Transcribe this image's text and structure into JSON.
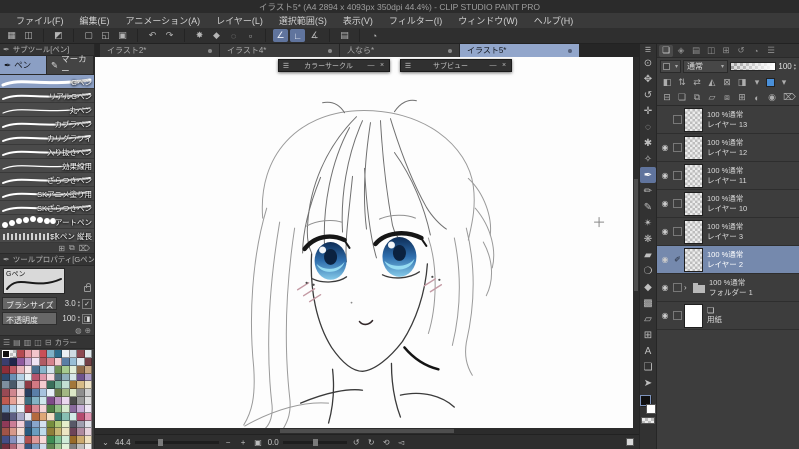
{
  "titlebar": {
    "title": "イラスト5* (A4 2894 x 4093px 350dpi 44.4%)  - CLIP STUDIO PAINT PRO"
  },
  "menubar": [
    "ファイル(F)",
    "編集(E)",
    "アニメーション(A)",
    "レイヤー(L)",
    "選択範囲(S)",
    "表示(V)",
    "フィルター(I)",
    "ウィンドウ(W)",
    "ヘルプ(H)"
  ],
  "commandbar": [
    {
      "name": "hide-palette-icon",
      "glyph": "▦"
    },
    {
      "name": "workspace-icon",
      "glyph": "◫"
    },
    {
      "sep": true
    },
    {
      "name": "clip-studio-logo",
      "glyph": "◩"
    },
    {
      "sep": true
    },
    {
      "name": "new-file-icon",
      "glyph": "▢"
    },
    {
      "name": "open-file-icon",
      "glyph": "◱"
    },
    {
      "name": "save-file-icon",
      "glyph": "▣"
    },
    {
      "sep": true
    },
    {
      "name": "undo-icon",
      "glyph": "↶"
    },
    {
      "name": "redo-icon",
      "glyph": "↷"
    },
    {
      "sep": true
    },
    {
      "name": "clear-icon",
      "glyph": "✸"
    },
    {
      "name": "fill-icon",
      "glyph": "◆"
    },
    {
      "name": "deselect-icon",
      "glyph": "◌"
    },
    {
      "name": "selection-launcher-icon",
      "glyph": "▫"
    },
    {
      "sep": true
    },
    {
      "name": "snap-to-ruler-icon",
      "glyph": "∠",
      "selected": true
    },
    {
      "name": "snap-to-special-ruler-icon",
      "glyph": "∟",
      "selected": true
    },
    {
      "name": "snap-to-grid-icon",
      "glyph": "∡"
    },
    {
      "sep": true
    },
    {
      "name": "reference-book-icon",
      "glyph": "▤"
    },
    {
      "sep": true
    },
    {
      "name": "help-icon",
      "glyph": "◔"
    }
  ],
  "tabs": [
    {
      "label": "イラスト2*"
    },
    {
      "label": "イラスト4*"
    },
    {
      "label": "人なら*"
    },
    {
      "label": "イラスト5*",
      "selected": true
    }
  ],
  "subtool": {
    "title": "サブツール[ペン]",
    "tabs": [
      {
        "label": "ペン",
        "glyph": "✒",
        "selected": true
      },
      {
        "label": "マーカー",
        "glyph": "✎"
      }
    ],
    "brushes": [
      {
        "label": "Gペン",
        "selected": true,
        "style": "taper"
      },
      {
        "label": "リアルGペン",
        "style": "s"
      },
      {
        "label": "丸ペン",
        "style": "thin"
      },
      {
        "label": "カブラペン",
        "style": "s"
      },
      {
        "label": "カリグラフィ",
        "style": "s"
      },
      {
        "label": "入り抜きペン",
        "style": "s"
      },
      {
        "label": "効果線用",
        "style": "thin"
      },
      {
        "label": "ざらつきペン",
        "style": "s"
      },
      {
        "label": "SKアニメ塗り用",
        "style": "s"
      },
      {
        "label": "SKざらつきペン",
        "style": "s"
      },
      {
        "label": "アートペン",
        "style": "dots"
      },
      {
        "label": "SKペン 縦長",
        "style": "bars"
      }
    ],
    "footer": [
      {
        "name": "add-subtool-icon",
        "glyph": "⊞"
      },
      {
        "name": "duplicate-subtool-icon",
        "glyph": "⧉"
      },
      {
        "name": "delete-subtool-icon",
        "glyph": "⌦"
      }
    ]
  },
  "toolprop": {
    "title": "ツールプロパティ[Gペン]",
    "preview_label": "Gペン",
    "props": [
      {
        "label": "ブラシサイズ",
        "value": "3.0",
        "fill": 38,
        "control": "check"
      },
      {
        "label": "不透明度",
        "value": "100",
        "fill": 100,
        "control": "box"
      }
    ],
    "footer": [
      {
        "name": "stroke-preview-toggle-icon",
        "glyph": "◍"
      },
      {
        "name": "show-all-properties-icon",
        "glyph": "⊕"
      }
    ]
  },
  "colorset": {
    "title": "カラー",
    "header_icons": [
      {
        "name": "colorset-menu-icon",
        "glyph": "☰"
      },
      {
        "name": "colorset-tab-1-icon",
        "glyph": "▤"
      },
      {
        "name": "colorset-tab-2-icon",
        "glyph": "▥"
      },
      {
        "name": "colorset-tab-3-icon",
        "glyph": "◫"
      },
      {
        "name": "colorset-settings-icon",
        "glyph": "⊟"
      }
    ],
    "selected": [
      0,
      0
    ],
    "swatches": [
      [
        "#111111",
        "T",
        "#b44a50",
        "#e79aa3",
        "#f2c5cb",
        "#c94f58",
        "#7fb2c8",
        "#2e6e8e",
        "#ebf1f4",
        "#cfdbe3",
        "#8c4a52",
        "#dfe7eb"
      ],
      [
        "#3a3f6e",
        "#20254a",
        "#8e5a9e",
        "#c7a7d3",
        "#efe3f3",
        "#b05a64",
        "#d4838d",
        "#f4cfd3",
        "#5a7ea4",
        "#99bfd7",
        "#e3ebf1",
        "#734047"
      ],
      [
        "#8e2e38",
        "#c05a64",
        "#e9b3b9",
        "#f7e7e9",
        "#4a6e8e",
        "#88b4cb",
        "#d3e3ed",
        "#6a8e54",
        "#a7cb8f",
        "#e3efd9",
        "#8d6949",
        "#c7a783"
      ],
      [
        "#2e4a6e",
        "#6a90b4",
        "#b3cfe3",
        "#ebf3f7",
        "#b4556e",
        "#df97ab",
        "#f7dbe3",
        "#54707e",
        "#8fafbb",
        "#d7e7eb",
        "#6d538d",
        "#af9fcb"
      ],
      [
        "#7e8e9e",
        "#4a5a6a",
        "#c3cfd9",
        "#8e3a44",
        "#d37983",
        "#f3cbcf",
        "#3a6e5a",
        "#77af97",
        "#c3dfd3",
        "#a3773a",
        "#d7bb87",
        "#efe3c7"
      ],
      [
        "#984a54",
        "#cf878f",
        "#f3d3d7",
        "#2a3e5e",
        "#5a7ea7",
        "#a7c3df",
        "#e7eff7",
        "#6a7a4a",
        "#a3b783",
        "#dbe7c7",
        "#8e8e8e",
        "#cfcfcf"
      ],
      [
        "#c05a50",
        "#e7a397",
        "#f7dfdb",
        "#3e6e80",
        "#83b3c3",
        "#cfe7ed",
        "#7e4a88",
        "#bb93c3",
        "#ebd7ef",
        "#4a4a4a",
        "#999999",
        "#dfdfdf"
      ],
      [
        "#6e8eb4",
        "#b7cfe7",
        "#edf3f9",
        "#a83e4a",
        "#d78993",
        "#f5d5d9",
        "#507e46",
        "#93bf87",
        "#d7ebcf",
        "#896a9d",
        "#c7afd7",
        "#efe7f5"
      ],
      [
        "#2e2e44",
        "#5e5e84",
        "#a7a7c7",
        "#e7e7f1",
        "#b46a3e",
        "#dfa777",
        "#f5dfc7",
        "#3e7e74",
        "#87bfb3",
        "#d3ebe7",
        "#b44a6e",
        "#e397b3"
      ],
      [
        "#8e3a58",
        "#cb7d97",
        "#f1cfdb",
        "#46628e",
        "#89a5cb",
        "#d5e1f1",
        "#768e3e",
        "#afc777",
        "#e5efcb",
        "#585868",
        "#9f9faf",
        "#e1e1e9"
      ],
      [
        "#a05448",
        "#d7998b",
        "#f5ddd5",
        "#2a5a7e",
        "#699dbf",
        "#bfdbeb",
        "#8e7e3a",
        "#c7b777",
        "#ede5c3",
        "#6e4458",
        "#af8b9f",
        "#e7d3dd"
      ],
      [
        "#444e86",
        "#8791bf",
        "#d1d7ed",
        "#b05050",
        "#df9999",
        "#f7d9d9",
        "#3e8e54",
        "#83c397",
        "#cfebd7",
        "#986a28",
        "#cbaa6f",
        "#efe1bf"
      ],
      [
        "#702e3e",
        "#af6777",
        "#e5b7c1",
        "#35547e",
        "#7c9bbf",
        "#cedded",
        "#5e8450",
        "#a1c793",
        "#e3f1d9",
        "#7e7e7e",
        "#bdbdbd",
        "#efefef"
      ]
    ]
  },
  "canvas": {
    "floating": [
      {
        "title": "カラーサークル"
      },
      {
        "title": "サブビュー"
      }
    ],
    "zoom": "44.4",
    "rotation": "0.0",
    "minimize_glyph": "—",
    "close_glyph": "×",
    "menu_glyph": "☰"
  },
  "navbar": {
    "caret": "⌄",
    "zoom_icons": [
      {
        "name": "zoom-out-icon",
        "glyph": "−"
      },
      {
        "name": "zoom-in-icon",
        "glyph": "+"
      },
      {
        "name": "fit-to-screen-icon",
        "glyph": "▣"
      }
    ],
    "rot_icons": [
      {
        "name": "rotate-ccw-icon",
        "glyph": "↺"
      },
      {
        "name": "rotate-cw-icon",
        "glyph": "↻"
      },
      {
        "name": "reset-rotation-icon",
        "glyph": "⟲"
      },
      {
        "name": "flip-horizontal-icon",
        "glyph": "◅"
      }
    ]
  },
  "toolstrip": [
    {
      "name": "tool-menu-icon",
      "glyph": "☰",
      "small": true
    },
    {
      "name": "zoom-tool",
      "glyph": "⊙"
    },
    {
      "name": "hand-tool",
      "glyph": "✥"
    },
    {
      "name": "rotate-canvas-tool",
      "glyph": "↺"
    },
    {
      "name": "move-layer-tool",
      "glyph": "✛"
    },
    {
      "name": "selection-tool",
      "glyph": "◌"
    },
    {
      "name": "auto-select-tool",
      "glyph": "✱"
    },
    {
      "name": "eyedropper-tool",
      "glyph": "✧"
    },
    {
      "name": "pen-tool",
      "glyph": "✒",
      "selected": true
    },
    {
      "name": "pencil-tool",
      "glyph": "✏"
    },
    {
      "name": "brush-tool",
      "glyph": "✎"
    },
    {
      "name": "airbrush-tool",
      "glyph": "✴"
    },
    {
      "name": "decoration-tool",
      "glyph": "❋"
    },
    {
      "name": "eraser-tool",
      "glyph": "▰"
    },
    {
      "name": "blend-tool",
      "glyph": "❍"
    },
    {
      "name": "fill-tool",
      "glyph": "◆"
    },
    {
      "name": "gradient-tool",
      "glyph": "▩"
    },
    {
      "name": "figure-tool",
      "glyph": "▱"
    },
    {
      "name": "frame-border-tool",
      "glyph": "⊞"
    },
    {
      "name": "text-tool",
      "glyph": "A"
    },
    {
      "name": "balloon-tool",
      "glyph": "❏"
    },
    {
      "name": "operation-tool",
      "glyph": "➤"
    }
  ],
  "layers": {
    "palette_tabs": [
      {
        "name": "layer-palette-tab",
        "glyph": "❏",
        "selected": true
      },
      {
        "name": "layer-property-palette-tab",
        "glyph": "◈"
      },
      {
        "name": "animation-palette-tab",
        "glyph": "▤"
      },
      {
        "name": "layer-search-palette-tab",
        "glyph": "◫"
      },
      {
        "name": "navigator-palette-tab",
        "glyph": "⊞"
      },
      {
        "name": "history-palette-tab",
        "glyph": "↺"
      },
      {
        "name": "material-palette-tab",
        "glyph": "◔"
      },
      {
        "name": "layer-palette-menu-icon",
        "glyph": "☰"
      }
    ],
    "blend_mode": "通常",
    "opacity": "100",
    "toolbar1": [
      {
        "name": "change-palette-color-icon",
        "glyph": "◧"
      },
      {
        "name": "layer-order-icon",
        "glyph": "⇅"
      },
      {
        "name": "transfer-icon",
        "glyph": "⇄"
      },
      {
        "name": "lock-layer-icon",
        "glyph": "◭"
      },
      {
        "name": "lock-transparent-pixels-icon",
        "glyph": "⊠"
      },
      {
        "name": "mask-dropdown-icon",
        "glyph": "◨"
      },
      {
        "name": "ruler-dropdown-icon",
        "glyph": "▾"
      },
      {
        "name": "layer-color-swatch",
        "swatch": true
      },
      {
        "name": "layer-color-dropdown-icon",
        "glyph": "▾"
      }
    ],
    "toolbar2": [
      {
        "name": "layer-view-icon",
        "glyph": "⊟"
      },
      {
        "name": "new-raster-layer-icon",
        "glyph": "❏"
      },
      {
        "name": "new-layer-dropdown-icon",
        "glyph": "⧉"
      },
      {
        "name": "new-folder-icon",
        "glyph": "▱"
      },
      {
        "name": "merge-down-icon",
        "glyph": "⧈"
      },
      {
        "name": "combine-icon",
        "glyph": "⊞"
      },
      {
        "name": "create-mask-icon",
        "glyph": "◐"
      },
      {
        "name": "apply-mask-icon",
        "glyph": "◉"
      },
      {
        "name": "delete-layer-icon",
        "glyph": "⌦",
        "right": true
      }
    ],
    "eye_glyph": "◉",
    "edit_glyph": "✐",
    "expand_glyph": "›",
    "paper_icon_glyph": "❏",
    "items": [
      {
        "info": "100 %通常",
        "name": "レイヤー 13",
        "eye": false
      },
      {
        "info": "100 %通常",
        "name": "レイヤー 12",
        "eye": true
      },
      {
        "info": "100 %通常",
        "name": "レイヤー 11",
        "eye": true
      },
      {
        "info": "100 %通常",
        "name": "レイヤー 10",
        "eye": true
      },
      {
        "info": "100 %通常",
        "name": "レイヤー 3",
        "eye": true
      },
      {
        "info": "100 %通常",
        "name": "レイヤー 2",
        "eye": true,
        "selected": true,
        "editing": true
      },
      {
        "info": "100 %通常",
        "name": "フォルダー 1",
        "eye": true,
        "type": "folder"
      },
      {
        "info": "",
        "name": "用紙",
        "eye": true,
        "type": "paper"
      }
    ]
  }
}
